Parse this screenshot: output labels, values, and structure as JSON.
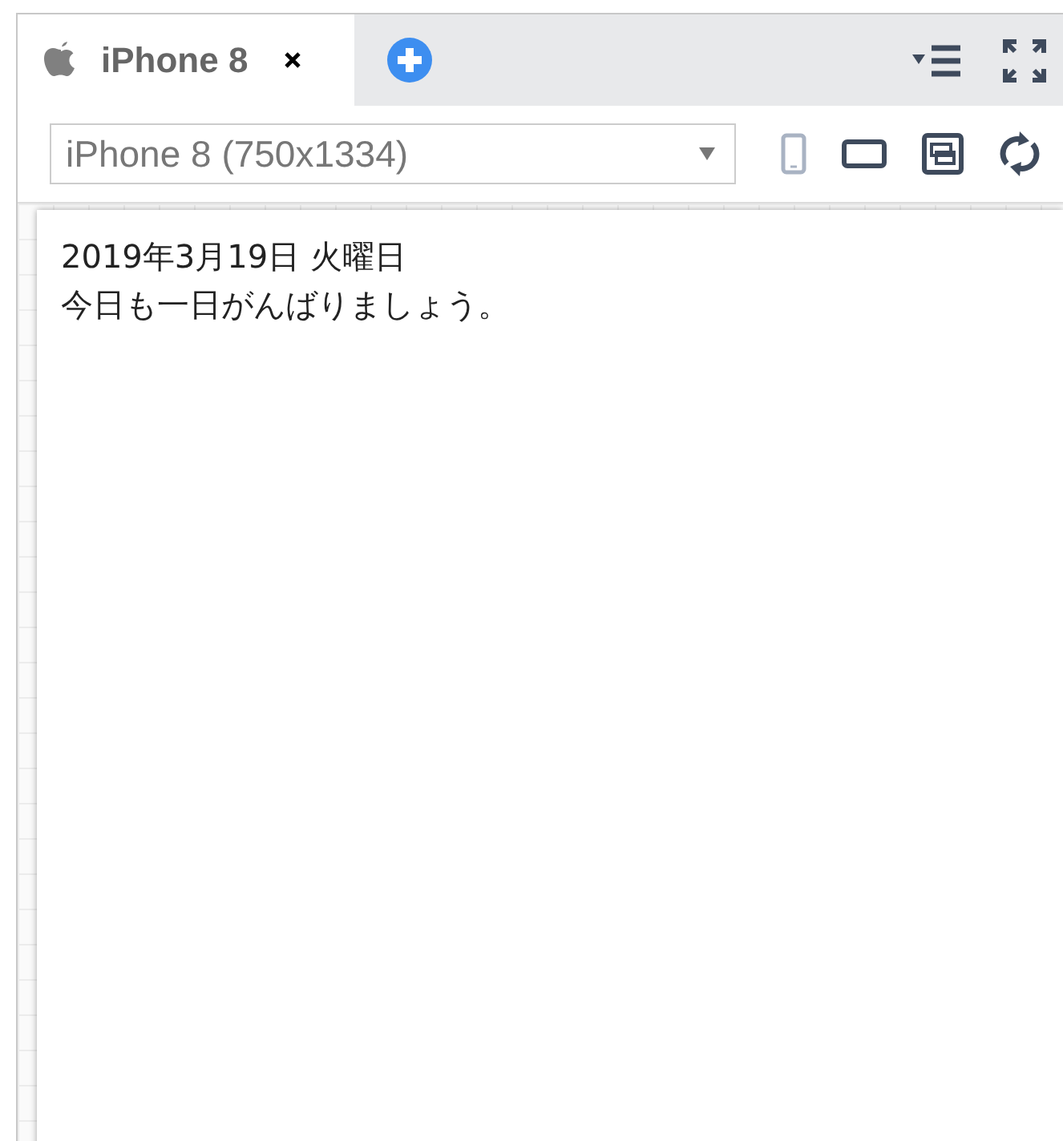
{
  "tabs": [
    {
      "label": "iPhone 8",
      "selected": true
    }
  ],
  "device_select": {
    "value": "iPhone 8 (750x1334)"
  },
  "orientation": {
    "portrait_selected": false
  },
  "screen": {
    "lines": [
      "2019年3月19日 火曜日",
      "今日も一日がんばりましょう。"
    ]
  }
}
